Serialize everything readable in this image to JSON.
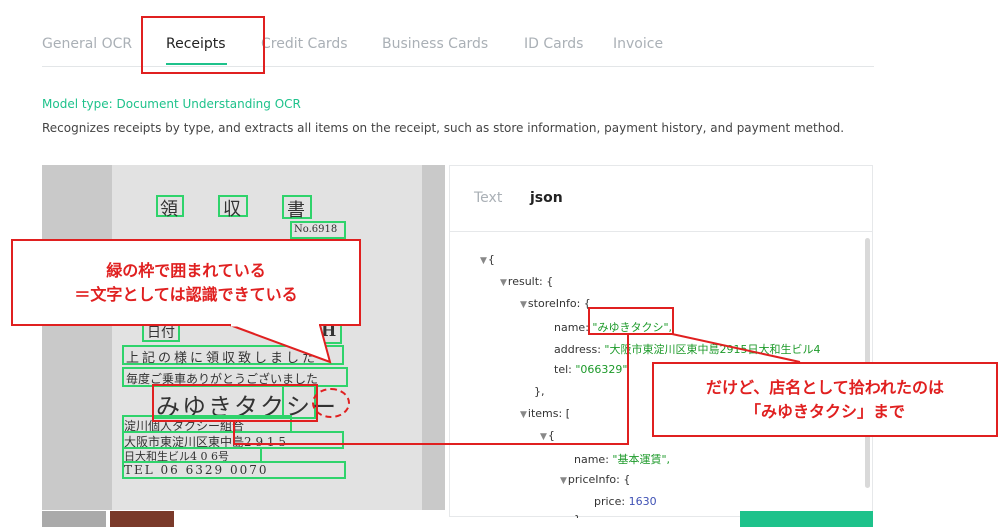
{
  "tabs": [
    {
      "label": "General OCR",
      "active": false
    },
    {
      "label": "Receipts",
      "active": true
    },
    {
      "label": "Credit Cards",
      "active": false
    },
    {
      "label": "Business Cards",
      "active": false
    },
    {
      "label": "ID Cards",
      "active": false
    },
    {
      "label": "Invoice",
      "active": false
    }
  ],
  "model_type": "Model type: Document Understanding OCR",
  "description": "Recognizes receipts by type, and extracts all items on the receipt, such as store information, payment history, and payment method.",
  "receipt": {
    "title_chars": [
      "領",
      "収",
      "書"
    ],
    "number": "No.6918",
    "line_date": "日付",
    "line_amount": "0H",
    "line1": "上記の様に領収致しました",
    "line2": "毎度ご乗車ありがとうございました",
    "store_name": "みゆきタクシー",
    "union": "淀川個人タクシー組合",
    "addr1": "大阪市東淀川区東中島2 9 1 5",
    "addr2": "日大和生ビル4 0 6号",
    "tel": "TEL 06 6329 0070"
  },
  "result_tabs": [
    {
      "label": "Text",
      "active": false
    },
    {
      "label": "json",
      "active": true
    }
  ],
  "json_view": {
    "open_brace": "{",
    "result_key": "result: {",
    "storeinfo_key": "storeInfo: {",
    "name_key": "name:",
    "name_value": "\"みゆきタクシ\",",
    "address_key": "address:",
    "address_value": "\"大阪市東淀川区東中島2915日大和生ビル4",
    "tel_key": "tel:",
    "tel_value": "\"066329\"",
    "close_obj": "},",
    "items_key": "items: [",
    "item_open": "{",
    "item_name_key": "name:",
    "item_name_value": "\"基本運賃\",",
    "priceinfo_key": "priceInfo: {",
    "price_key": "price:",
    "price_value": "1630",
    "close_brace": "}"
  },
  "annotations": {
    "callout_left_line1": "緑の枠で囲まれている",
    "callout_left_line2": "＝文字としては認識できている",
    "callout_right_line1": "だけど、店名として拾われたのは",
    "callout_right_line2": "「みゆきタクシ」まで"
  },
  "colors": {
    "accent_green": "#1ec28b",
    "ocr_box": "#2fd36b",
    "annotation_red": "#e02020",
    "json_string": "#1d9a2a",
    "json_number": "#3f51b5"
  }
}
